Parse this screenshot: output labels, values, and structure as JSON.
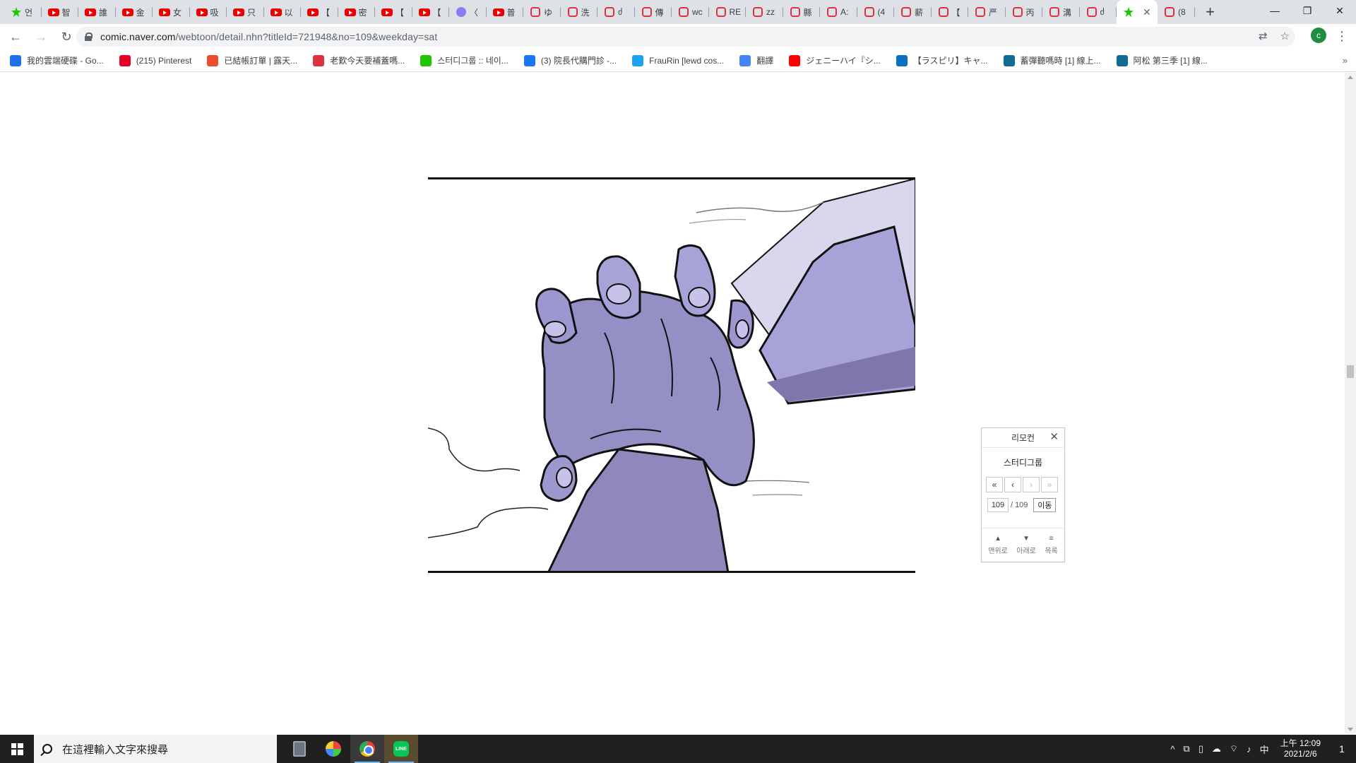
{
  "browser": {
    "tabs": [
      {
        "icon": "naver-webtoon-icon",
        "label": "언"
      },
      {
        "icon": "youtube-icon",
        "label": "智"
      },
      {
        "icon": "youtube-icon",
        "label": "誰"
      },
      {
        "icon": "youtube-icon",
        "label": "金"
      },
      {
        "icon": "youtube-icon",
        "label": "女"
      },
      {
        "icon": "youtube-icon",
        "label": "吸"
      },
      {
        "icon": "youtube-icon",
        "label": "只"
      },
      {
        "icon": "youtube-icon",
        "label": "以"
      },
      {
        "icon": "youtube-icon",
        "label": "【"
      },
      {
        "icon": "youtube-icon",
        "label": "密"
      },
      {
        "icon": "youtube-icon",
        "label": "【"
      },
      {
        "icon": "youtube-icon",
        "label": "【"
      },
      {
        "icon": "purple-app-icon",
        "label": "〈"
      },
      {
        "icon": "youtube-icon",
        "label": "普"
      },
      {
        "icon": "pixiv-icon",
        "label": "ゆ"
      },
      {
        "icon": "pixiv-icon",
        "label": "洗"
      },
      {
        "icon": "pixiv-icon",
        "label": "ძ"
      },
      {
        "icon": "pixiv-icon",
        "label": "傳"
      },
      {
        "icon": "pixiv-icon",
        "label": "wc"
      },
      {
        "icon": "pixiv-icon",
        "label": "RE"
      },
      {
        "icon": "pixiv-icon",
        "label": "zz"
      },
      {
        "icon": "pixiv-icon",
        "label": "縣"
      },
      {
        "icon": "pixiv-icon",
        "label": "A:"
      },
      {
        "icon": "pixiv-icon",
        "label": "(4"
      },
      {
        "icon": "pixiv-icon",
        "label": "薪"
      },
      {
        "icon": "pixiv-icon",
        "label": "【"
      },
      {
        "icon": "pixiv-icon",
        "label": "严"
      },
      {
        "icon": "pixiv-icon",
        "label": "丙"
      },
      {
        "icon": "pixiv-icon",
        "label": "溝"
      },
      {
        "icon": "pixiv-icon",
        "label": "ძ"
      },
      {
        "icon": "naver-webtoon-icon",
        "label": "",
        "active": true
      },
      {
        "icon": "pixiv-icon",
        "label": "(8"
      }
    ],
    "new_tab_label": "+",
    "window_controls": {
      "minimize": "—",
      "restore": "❐",
      "close": "✕"
    },
    "url_host": "comic.naver.com",
    "url_path": "/webtoon/detail.nhn?titleId=721948&no=109&weekday=sat",
    "profile_initial": "c",
    "bookmarks": [
      {
        "icon": "google-drive-icon",
        "color": "#1a73e8",
        "label": "我的雲端硬碟 - Go..."
      },
      {
        "icon": "pinterest-icon",
        "color": "#e60023",
        "label": "(215) Pinterest"
      },
      {
        "icon": "shopee-icon",
        "color": "#ee4d2d",
        "label": "已結帳訂單 | 露天..."
      },
      {
        "icon": "pixiv-icon",
        "color": "#e0313f",
        "label": "老歎今天要補蓋嗎..."
      },
      {
        "icon": "naver-webtoon-icon",
        "color": "#1ec800",
        "label": "스터디그룹 :: 네이..."
      },
      {
        "icon": "facebook-icon",
        "color": "#1877f2",
        "label": "(3) 院長代購門診 -..."
      },
      {
        "icon": "twitter-icon",
        "color": "#1da1f2",
        "label": "FrauRin [lewd cos..."
      },
      {
        "icon": "translate-icon",
        "color": "#4285f4",
        "label": "翻譯"
      },
      {
        "icon": "youtube-icon",
        "color": "#ff0000",
        "label": "ジェニーハイ『シ..."
      },
      {
        "icon": "circle-app-icon",
        "color": "#0b6fc4",
        "label": "【ラスピリ】キャ..."
      },
      {
        "icon": "manga-icon",
        "color": "#0f6c95",
        "label": "蓄彈聽嗎時 [1] 線上..."
      },
      {
        "icon": "manga-icon",
        "color": "#0f6c95",
        "label": "阿松 第三季 [1] 線..."
      }
    ],
    "bookmarks_more": "»"
  },
  "remote": {
    "header": "리모컨",
    "close": "✕",
    "title": "스터디그룹",
    "first": "«",
    "prev": "‹",
    "next": "›",
    "last": "»",
    "current_page": "109",
    "separator": "/",
    "total_pages": "109",
    "go_label": "이동",
    "top_label": "맨위로",
    "down_label": "아래로",
    "list_label": "목록"
  },
  "taskbar": {
    "search_placeholder": "在這裡輸入文字來搜尋",
    "apps": [
      "calculator-icon",
      "paint-icon",
      "chrome-icon",
      "line-icon"
    ],
    "tray": {
      "chevron": "^",
      "ime": "中",
      "time": "上午 12:09",
      "date": "2021/2/6",
      "notifications": "1"
    }
  },
  "colors": {
    "tab_strip": "#dee1e6",
    "hand_light": "#a7a3d9",
    "hand_dark": "#7f76ad",
    "outline": "#111111"
  }
}
